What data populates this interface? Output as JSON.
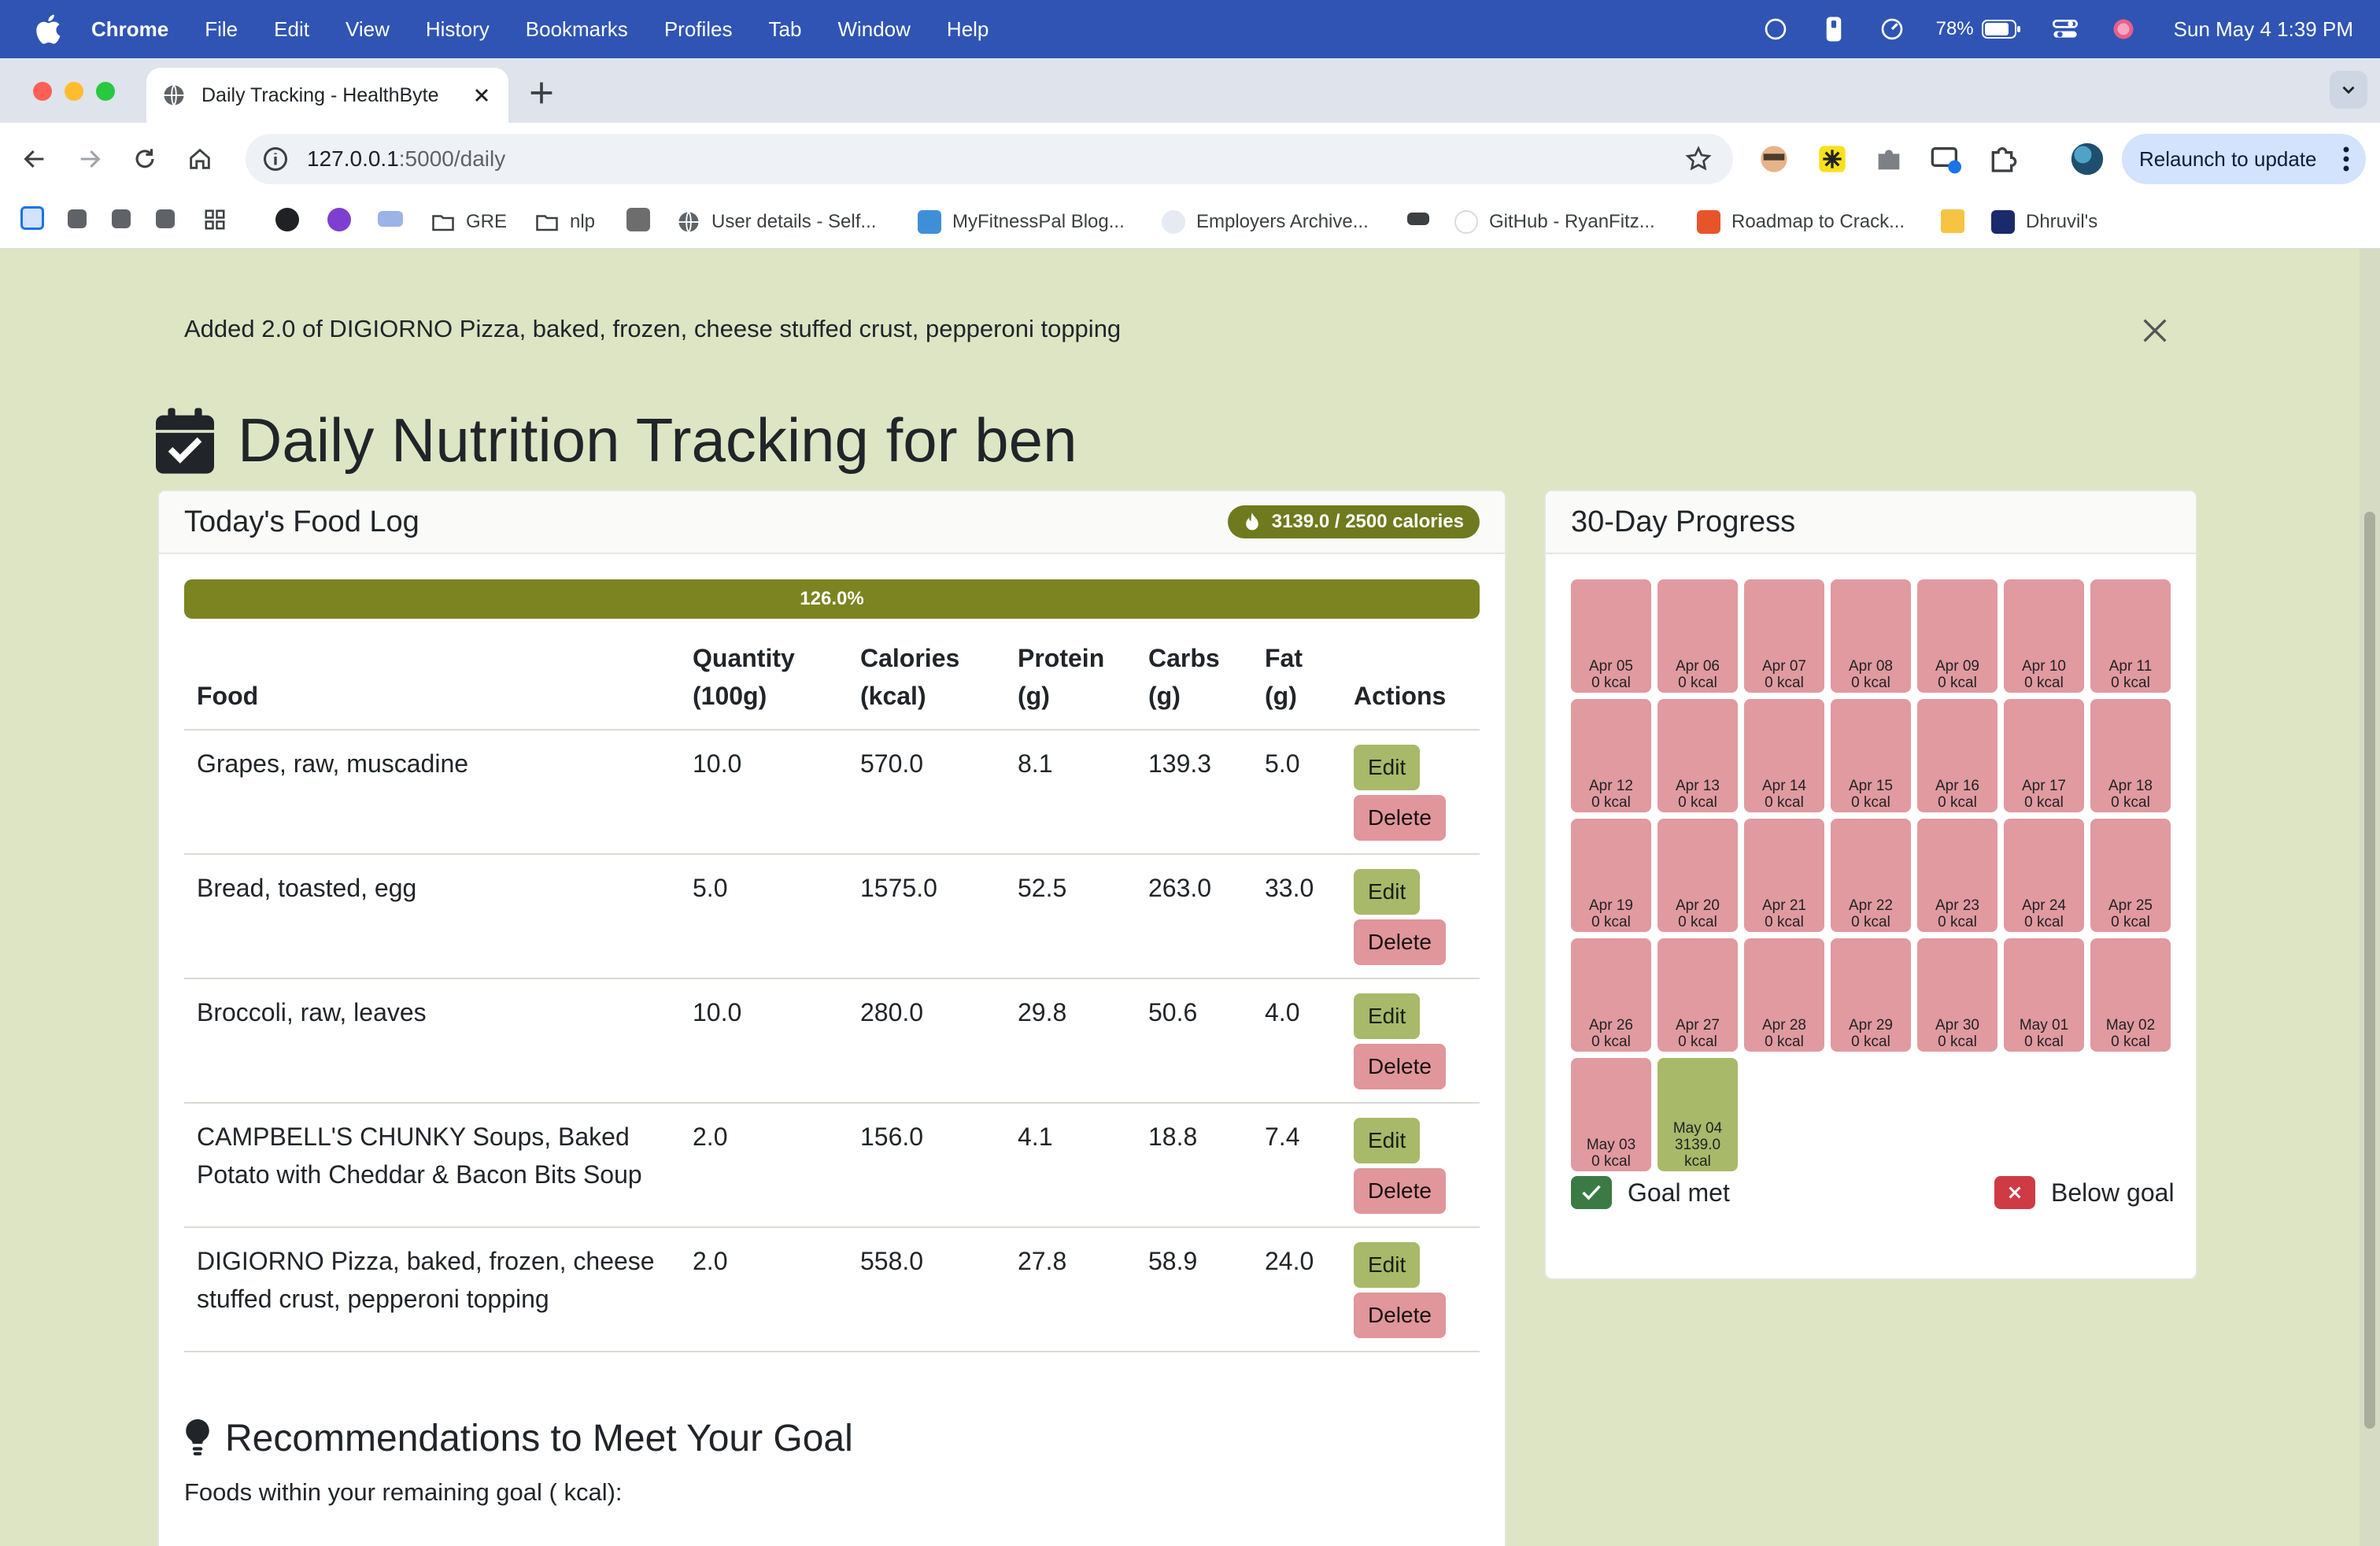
{
  "menubar": {
    "app_name": "Chrome",
    "items": [
      "File",
      "Edit",
      "View",
      "History",
      "Bookmarks",
      "Profiles",
      "Tab",
      "Window",
      "Help"
    ],
    "battery": "78%",
    "datetime": "Sun May 4  1:39 PM"
  },
  "browser": {
    "tab_title": "Daily Tracking - HealthByte",
    "url_host": "127.0.0.1",
    "url_path": ":5000/daily",
    "relaunch_label": "Relaunch to update",
    "bookmarks": [
      {
        "label": "GRE",
        "icon": "folder-icon"
      },
      {
        "label": "nlp",
        "icon": "folder-icon"
      },
      {
        "label": "User details - Self...",
        "icon": "globe-icon"
      },
      {
        "label": "MyFitnessPal Blog...",
        "icon": "mfp-icon"
      },
      {
        "label": "Employers Archive...",
        "icon": "fa-icon"
      },
      {
        "label": "GitHub - RyanFitz...",
        "icon": "github-icon"
      },
      {
        "label": "Roadmap to Crack...",
        "icon": "roadmap-icon"
      },
      {
        "label": "Dhruvil's",
        "icon": "dj-icon"
      }
    ]
  },
  "flash": {
    "message": "Added 2.0 of DIGIORNO Pizza, baked, frozen, cheese stuffed crust, pepperoni topping"
  },
  "page": {
    "title": "Daily Nutrition Tracking for ben"
  },
  "food_log": {
    "header": "Today's Food Log",
    "badge": "3139.0 / 2500 calories",
    "progress_label": "126.0%",
    "progress_percent": 126.0,
    "columns": {
      "food": "Food",
      "quantity": [
        "Quantity",
        "(100g)"
      ],
      "calories": [
        "Calories",
        "(kcal)"
      ],
      "protein": [
        "Protein",
        "(g)"
      ],
      "carbs": [
        "Carbs",
        "(g)"
      ],
      "fat": [
        "Fat",
        "(g)"
      ],
      "actions": "Actions"
    },
    "edit_label": "Edit",
    "delete_label": "Delete",
    "rows": [
      {
        "food": "Grapes, raw, muscadine",
        "quantity": "10.0",
        "calories": "570.0",
        "protein": "8.1",
        "carbs": "139.3",
        "fat": "5.0"
      },
      {
        "food": "Bread, toasted, egg",
        "quantity": "5.0",
        "calories": "1575.0",
        "protein": "52.5",
        "carbs": "263.0",
        "fat": "33.0"
      },
      {
        "food": "Broccoli, raw, leaves",
        "quantity": "10.0",
        "calories": "280.0",
        "protein": "29.8",
        "carbs": "50.6",
        "fat": "4.0"
      },
      {
        "food": "CAMPBELL'S CHUNKY Soups, Baked Potato with Cheddar & Bacon Bits Soup",
        "quantity": "2.0",
        "calories": "156.0",
        "protein": "4.1",
        "carbs": "18.8",
        "fat": "7.4"
      },
      {
        "food": "DIGIORNO Pizza, baked, frozen, cheese stuffed crust, pepperoni topping",
        "quantity": "2.0",
        "calories": "558.0",
        "protein": "27.8",
        "carbs": "58.9",
        "fat": "24.0"
      }
    ],
    "recommendations_title": "Recommendations to Meet Your Goal",
    "recommendations_sub": "Foods within your remaining goal ( kcal):"
  },
  "progress_30day": {
    "header": "30-Day Progress",
    "days": [
      {
        "date": "Apr 05",
        "kcal": "0 kcal",
        "met": false
      },
      {
        "date": "Apr 06",
        "kcal": "0 kcal",
        "met": false
      },
      {
        "date": "Apr 07",
        "kcal": "0 kcal",
        "met": false
      },
      {
        "date": "Apr 08",
        "kcal": "0 kcal",
        "met": false
      },
      {
        "date": "Apr 09",
        "kcal": "0 kcal",
        "met": false
      },
      {
        "date": "Apr 10",
        "kcal": "0 kcal",
        "met": false
      },
      {
        "date": "Apr 11",
        "kcal": "0 kcal",
        "met": false
      },
      {
        "date": "Apr 12",
        "kcal": "0 kcal",
        "met": false
      },
      {
        "date": "Apr 13",
        "kcal": "0 kcal",
        "met": false
      },
      {
        "date": "Apr 14",
        "kcal": "0 kcal",
        "met": false
      },
      {
        "date": "Apr 15",
        "kcal": "0 kcal",
        "met": false
      },
      {
        "date": "Apr 16",
        "kcal": "0 kcal",
        "met": false
      },
      {
        "date": "Apr 17",
        "kcal": "0 kcal",
        "met": false
      },
      {
        "date": "Apr 18",
        "kcal": "0 kcal",
        "met": false
      },
      {
        "date": "Apr 19",
        "kcal": "0 kcal",
        "met": false
      },
      {
        "date": "Apr 20",
        "kcal": "0 kcal",
        "met": false
      },
      {
        "date": "Apr 21",
        "kcal": "0 kcal",
        "met": false
      },
      {
        "date": "Apr 22",
        "kcal": "0 kcal",
        "met": false
      },
      {
        "date": "Apr 23",
        "kcal": "0 kcal",
        "met": false
      },
      {
        "date": "Apr 24",
        "kcal": "0 kcal",
        "met": false
      },
      {
        "date": "Apr 25",
        "kcal": "0 kcal",
        "met": false
      },
      {
        "date": "Apr 26",
        "kcal": "0 kcal",
        "met": false
      },
      {
        "date": "Apr 27",
        "kcal": "0 kcal",
        "met": false
      },
      {
        "date": "Apr 28",
        "kcal": "0 kcal",
        "met": false
      },
      {
        "date": "Apr 29",
        "kcal": "0 kcal",
        "met": false
      },
      {
        "date": "Apr 30",
        "kcal": "0 kcal",
        "met": false
      },
      {
        "date": "May 01",
        "kcal": "0 kcal",
        "met": false
      },
      {
        "date": "May 02",
        "kcal": "0 kcal",
        "met": false
      },
      {
        "date": "May 03",
        "kcal": "0 kcal",
        "met": false
      },
      {
        "date": "May 04",
        "kcal": "3139.0 kcal",
        "met": true
      }
    ],
    "legend_met": "Goal met",
    "legend_below": "Below goal"
  },
  "colors": {
    "page_bg": "#dde5c4",
    "accent_olive": "#7c8422",
    "goal_met": "#a8b96a",
    "below_goal": "#e09aa0",
    "legend_met": "#3b7a45",
    "legend_below": "#cf3b45"
  }
}
